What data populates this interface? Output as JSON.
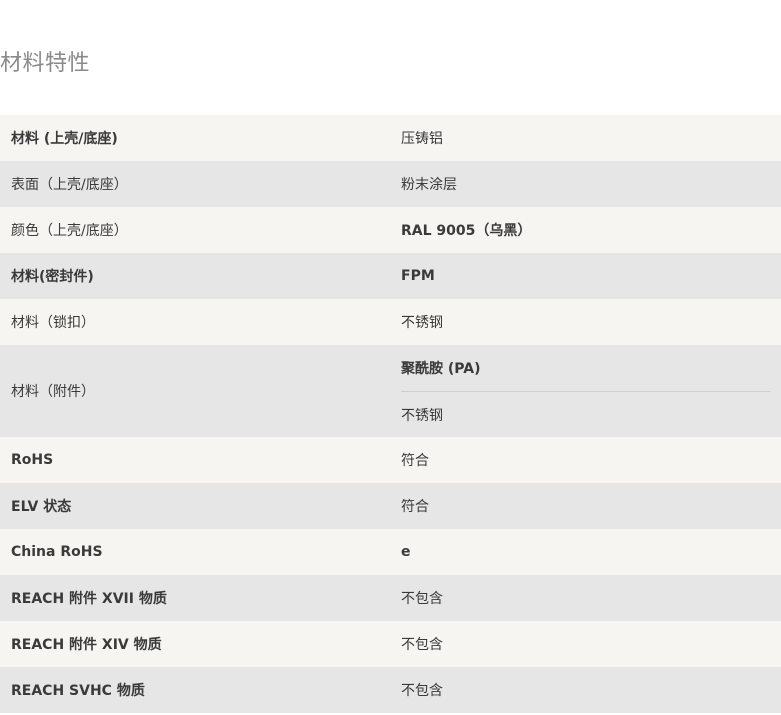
{
  "section": {
    "title": "材料特性"
  },
  "rows": [
    {
      "label": "材料 (上壳/底座)",
      "values": [
        "压铸铝"
      ]
    },
    {
      "label": "表面（上壳/底座）",
      "values": [
        "粉末涂层"
      ]
    },
    {
      "label": "颜色（上壳/底座）",
      "values": [
        "RAL 9005（乌黑）"
      ]
    },
    {
      "label": "材料(密封件)",
      "values": [
        "FPM"
      ]
    },
    {
      "label": "材料（锁扣）",
      "values": [
        "不锈钢"
      ]
    },
    {
      "label": "材料（附件）",
      "values": [
        "聚酰胺 (PA)",
        "不锈钢"
      ]
    },
    {
      "label": "RoHS",
      "values": [
        "符合"
      ]
    },
    {
      "label": "ELV 状态",
      "values": [
        "符合"
      ]
    },
    {
      "label": "China RoHS",
      "values": [
        "e"
      ]
    },
    {
      "label": "REACH 附件 XVII 物质",
      "values": [
        "不包含"
      ]
    },
    {
      "label": "REACH 附件 XIV 物质",
      "values": [
        "不包含"
      ]
    },
    {
      "label": "REACH SVHC 物质",
      "values": [
        "不包含"
      ]
    }
  ]
}
